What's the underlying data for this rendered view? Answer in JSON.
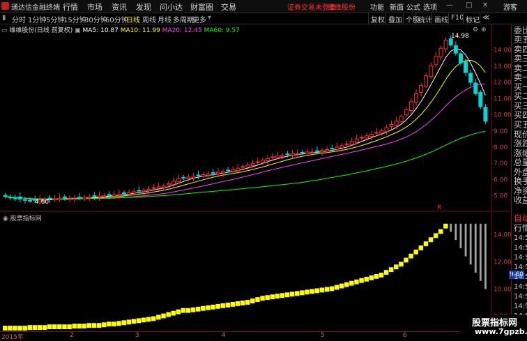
{
  "menubar": {
    "app_title": "通达信金融终端",
    "items": [
      "行情",
      "市场",
      "资讯",
      "发现",
      "问小达",
      "财富圈",
      "交易"
    ],
    "notice": "证券交易未登录",
    "account": "维维股份",
    "right_items": [
      "功能",
      "新面",
      "公式",
      "选项"
    ],
    "guest": "游客"
  },
  "periods": [
    "分时",
    "1分钟",
    "5分钟",
    "15分钟",
    "30分钟",
    "60分钟",
    "日线",
    "周线",
    "月线",
    "多周期",
    "更多"
  ],
  "active_period": "日线",
  "toolbar_right": [
    "复权",
    "叠加",
    "个股",
    "统计",
    "画线",
    "F10",
    "标记",
    "≪"
  ],
  "stock_label": "维维股份(日线 前复权)",
  "ma": {
    "ma5": "MA5: 10.87",
    "ma10": "MA10: 11.99",
    "ma20": "MA20: 12.45",
    "ma60": "MA60: 9.57",
    "colors": {
      "ma5": "#ffffff",
      "ma10": "#ffff00",
      "ma20": "#ff40ff",
      "ma60": "#00ff00"
    }
  },
  "price_axis": [
    "14.00",
    "13.00",
    "12.00",
    "11.00",
    "10.00",
    "9.00",
    "8.00",
    "7.00",
    "6.00",
    "5.00"
  ],
  "high_label": "14.98",
  "low_label": "4.60",
  "indicator_title": "股票指标网",
  "indicator_axis": [
    "14.00",
    "12.00",
    "10.00",
    "8.00"
  ],
  "price_tag": "9.60",
  "x_labels": [
    "2015年",
    "2",
    "3",
    "4",
    "5",
    "6"
  ],
  "side_panel": {
    "items": [
      "委比",
      "卖五",
      "卖四",
      "卖三",
      "卖二",
      "卖一",
      "买一",
      "买二",
      "买三",
      "买四",
      "买五",
      "现价",
      "涨跌",
      "涨幅",
      "总量",
      "外盘",
      "换手",
      "净资",
      "收益"
    ],
    "lower": [
      "自动",
      "行情"
    ],
    "times": [
      "14:50",
      "14:50",
      "14:50",
      "14:50",
      "14:5",
      "14:50",
      "14:50",
      "14:50",
      "14:50",
      "14:50"
    ]
  },
  "watermark": {
    "line1": "股票指标网",
    "line2": "www.7gpzb.com"
  },
  "chart_data": {
    "type": "candlestick",
    "title": "维维股份(日线 前复权)",
    "main_series": [
      {
        "name": "MA5",
        "color": "#ffffff"
      },
      {
        "name": "MA10",
        "color": "#ffff00"
      },
      {
        "name": "MA20",
        "color": "#ff40ff"
      },
      {
        "name": "MA60",
        "color": "#00ff00"
      }
    ],
    "x_months": [
      "2015年",
      "2",
      "3",
      "4",
      "5",
      "6"
    ],
    "ylim": [
      4.3,
      15.4
    ],
    "closes": [
      4.95,
      4.9,
      4.85,
      4.8,
      4.75,
      4.7,
      4.72,
      4.75,
      4.78,
      4.8,
      4.82,
      4.85,
      4.88,
      4.85,
      4.83,
      4.85,
      4.9,
      4.92,
      4.95,
      4.98,
      5.0,
      5.02,
      5.05,
      5.1,
      5.15,
      5.2,
      5.25,
      5.3,
      5.35,
      5.4,
      5.5,
      5.55,
      5.6,
      5.75,
      5.9,
      6.05,
      6.1,
      6.15,
      6.2,
      6.25,
      6.3,
      6.35,
      6.4,
      6.45,
      6.5,
      6.55,
      6.6,
      6.7,
      6.8,
      6.9,
      7.0,
      7.1,
      7.2,
      7.3,
      7.4,
      7.45,
      7.5,
      7.55,
      7.6,
      7.6,
      7.65,
      7.7,
      7.7,
      7.75,
      7.8,
      7.85,
      7.9,
      8.0,
      8.1,
      8.2,
      8.35,
      8.5,
      8.6,
      8.7,
      8.8,
      8.9,
      9.0,
      9.2,
      9.4,
      9.6,
      9.9,
      10.3,
      10.8,
      11.3,
      11.8,
      12.4,
      13.0,
      13.6,
      14.1,
      14.6,
      14.3,
      13.8,
      13.2,
      12.6,
      12.0,
      11.3,
      10.5,
      9.6
    ],
    "indicator": {
      "title": "股票指标网",
      "ylim": [
        7.0,
        15.2
      ],
      "values": [
        7.3,
        7.3,
        7.3,
        7.3,
        7.3,
        7.35,
        7.35,
        7.35,
        7.35,
        7.4,
        7.4,
        7.4,
        7.4,
        7.4,
        7.45,
        7.45,
        7.45,
        7.5,
        7.5,
        7.5,
        7.55,
        7.6,
        7.6,
        7.65,
        7.7,
        7.75,
        7.8,
        7.85,
        7.9,
        7.95,
        8.0,
        8.1,
        8.2,
        8.3,
        8.4,
        8.5,
        8.6,
        8.6,
        8.65,
        8.7,
        8.75,
        8.8,
        8.85,
        8.9,
        8.95,
        9.0,
        9.05,
        9.1,
        9.15,
        9.2,
        9.3,
        9.4,
        9.5,
        9.55,
        9.6,
        9.65,
        9.7,
        9.75,
        9.8,
        9.85,
        9.9,
        9.95,
        10.0,
        10.05,
        10.1,
        10.15,
        10.2,
        10.3,
        10.4,
        10.5,
        10.6,
        10.7,
        10.8,
        10.9,
        11.0,
        11.1,
        11.2,
        11.4,
        11.6,
        11.8,
        12.0,
        12.3,
        12.6,
        12.9,
        13.2,
        13.5,
        13.8,
        14.1,
        14.4,
        14.8,
        14.8,
        14.8,
        14.8,
        14.8,
        14.8,
        14.8,
        14.8,
        14.8
      ],
      "bar_color": "#ffff00",
      "fade_color": "#a0a0a0"
    }
  }
}
